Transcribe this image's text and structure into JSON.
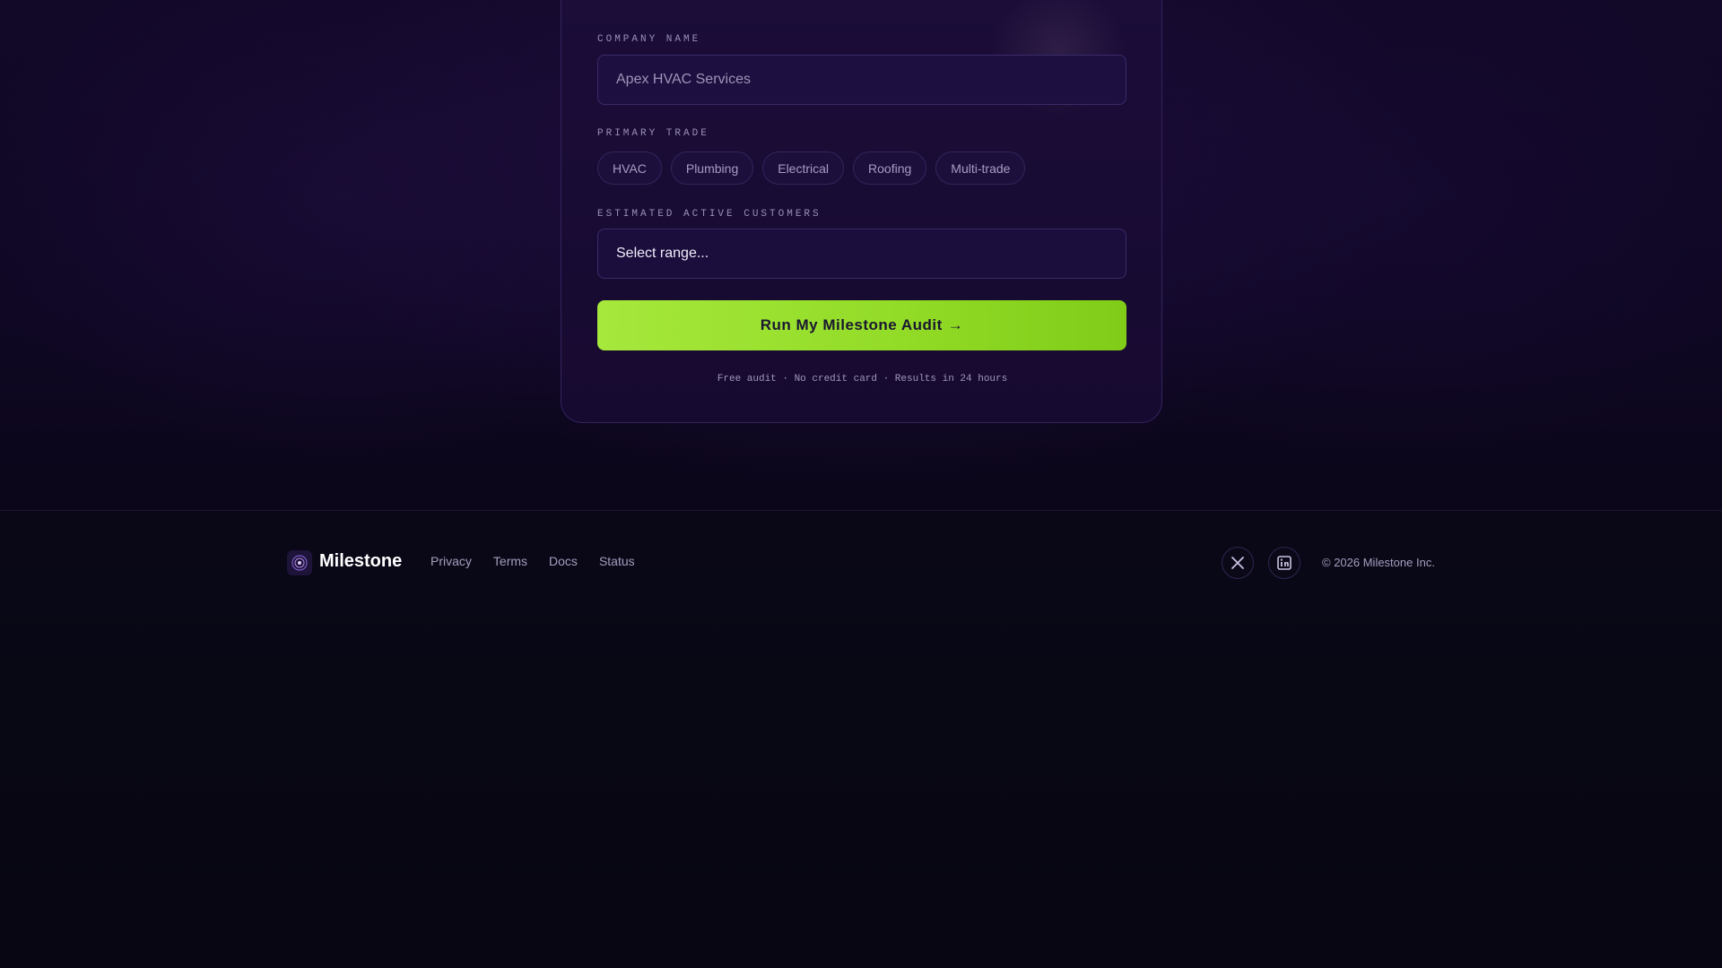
{
  "form": {
    "company_label": "COMPANY NAME",
    "company_placeholder": "Apex HVAC Services",
    "trade_label": "PRIMARY TRADE",
    "trades": [
      "HVAC",
      "Plumbing",
      "Electrical",
      "Roofing",
      "Multi-trade"
    ],
    "customers_label": "ESTIMATED ACTIVE CUSTOMERS",
    "customers_selected": "Select range...",
    "cta_label": "Run My Milestone Audit",
    "cta_arrow": "→",
    "fine_print": "Free audit · No credit card · Results in 24 hours"
  },
  "footer": {
    "brand": "Milestone",
    "links": [
      "Privacy",
      "Terms",
      "Docs",
      "Status"
    ],
    "social": [
      "x-icon",
      "linkedin-icon"
    ],
    "copyright": "© 2026 Milestone Inc."
  },
  "colors": {
    "accent": "#9ee035",
    "background": "#07060f",
    "card": "#1a0c36"
  }
}
